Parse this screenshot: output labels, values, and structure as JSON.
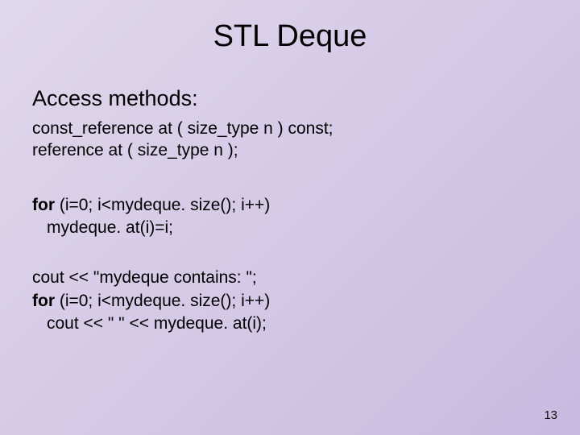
{
  "title": "STL Deque",
  "subtitle": "Access methods:",
  "signatures": {
    "line1": "const_reference at ( size_type n ) const;",
    "line2": "reference at ( size_type n );"
  },
  "example1": {
    "for_kw": "for",
    "for_rest": " (i=0; i<mydeque. size(); i++)",
    "body": "mydeque. at(i)=i;"
  },
  "example2": {
    "line1": "cout << \"mydeque contains: \";",
    "for_kw": "for",
    "for_rest": " (i=0; i<mydeque. size(); i++)",
    "body": "cout << \" \" << mydeque. at(i);"
  },
  "page_number": "13"
}
